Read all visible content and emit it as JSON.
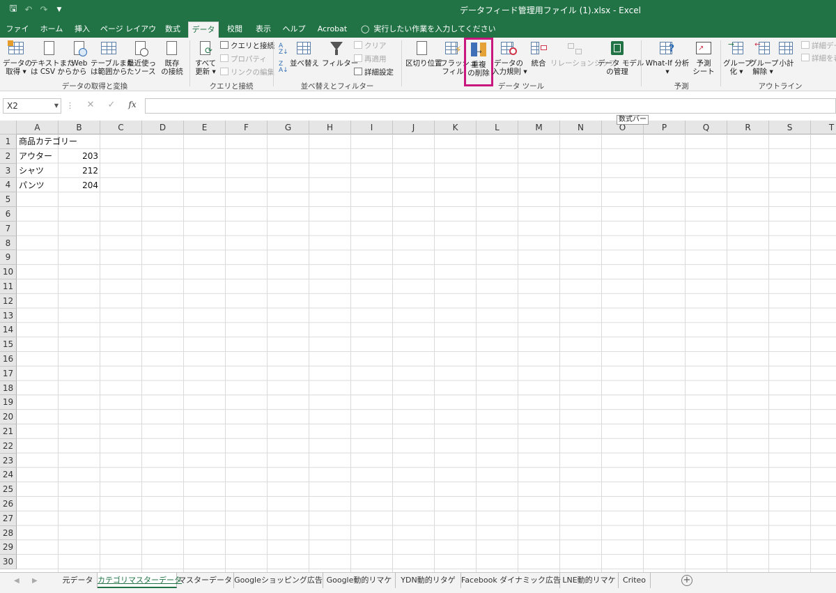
{
  "titlebar": {
    "title": "データフィード管理用ファイル (1).xlsx  -  Excel",
    "qat": {
      "save_icon": "save-icon",
      "undo_icon": "undo-icon",
      "redo_icon": "redo-icon",
      "customize_icon": "customize-qat-icon"
    }
  },
  "tabs": [
    "ファイル",
    "ホーム",
    "挿入",
    "ページ レイアウト",
    "数式",
    "データ",
    "校閲",
    "表示",
    "ヘルプ",
    "Acrobat"
  ],
  "active_tab": "データ",
  "tell_me": "実行したい作業を入力してください",
  "ribbon": {
    "get_data": {
      "group": "データの取得と変換",
      "buttons": [
        {
          "l1": "データの",
          "l2": "取得 ▾"
        },
        {
          "l1": "テキストまた",
          "l2": "は CSV から"
        },
        {
          "l1": "Web",
          "l2": "から"
        },
        {
          "l1": "テーブルまた",
          "l2": "は範囲から"
        },
        {
          "l1": "最近使っ",
          "l2": "たソース"
        },
        {
          "l1": "既存",
          "l2": "の接続"
        }
      ]
    },
    "queries": {
      "group": "クエリと接続",
      "refresh": {
        "l1": "すべて",
        "l2": "更新 ▾"
      },
      "small": [
        "クエリと接続",
        "プロパティ",
        "リンクの編集"
      ]
    },
    "sort_filter": {
      "group": "並べ替えとフィルター",
      "sort": "並べ替え",
      "filter": "フィルター",
      "clear": "クリア",
      "reapply": "再適用",
      "advanced": "詳細設定"
    },
    "data_tools": {
      "group": "データ ツール",
      "buttons": [
        {
          "l1": "区切り位置",
          "l2": ""
        },
        {
          "l1": "フラッシュ",
          "l2": "フィル"
        },
        {
          "l1": "重複",
          "l2": "の削除"
        },
        {
          "l1": "データの",
          "l2": "入力規則 ▾"
        },
        {
          "l1": "統合",
          "l2": ""
        },
        {
          "l1": "リレーションシップ",
          "l2": ""
        },
        {
          "l1": "データ モデル",
          "l2": "の管理"
        }
      ],
      "highlight_color": "#c8187d"
    },
    "forecast": {
      "group": "予測",
      "whatif": {
        "l1": "What-If 分析",
        "l2": "▾"
      },
      "sheet": {
        "l1": "予測",
        "l2": "シート"
      }
    },
    "outline": {
      "group": "アウトライン",
      "buttons": [
        {
          "l1": "グループ",
          "l2": "化 ▾"
        },
        {
          "l1": "グループ",
          "l2": "解除 ▾"
        },
        {
          "l1": "小計",
          "l2": ""
        }
      ],
      "small": [
        "詳細デー",
        "詳細を表"
      ]
    }
  },
  "formula_bar": {
    "name_box": "X2",
    "tooltip": "数式バー",
    "value": ""
  },
  "grid": {
    "columns": [
      "A",
      "B",
      "C",
      "D",
      "E",
      "F",
      "G",
      "H",
      "I",
      "J",
      "K",
      "L",
      "M",
      "N",
      "O",
      "P",
      "Q",
      "R",
      "S",
      "T"
    ],
    "rows": [
      "1",
      "2",
      "3",
      "4",
      "5",
      "6",
      "7",
      "8",
      "9",
      "10",
      "11",
      "12",
      "13",
      "14",
      "15",
      "16",
      "17",
      "18",
      "19",
      "20",
      "21",
      "22",
      "23",
      "24",
      "25",
      "26",
      "27",
      "28",
      "29",
      "30"
    ],
    "cells": {
      "A1": "商品カテゴリー",
      "A2": "アウター",
      "B2": "203",
      "A3": "シャツ",
      "B3": "212",
      "A4": "パンツ",
      "B4": "204"
    }
  },
  "sheet_tabs": [
    "元データ",
    "カテゴリマスターデータ",
    "マスターデータ",
    "Googleショッピング広告",
    "Google動的リマケ",
    "YDN動的リタゲ",
    "Facebook ダイナミック広告",
    "LNE動的リマケ",
    "Criteo"
  ],
  "active_sheet": "カテゴリマスターデータ",
  "colors": {
    "excel_green": "#217346",
    "ribbon_bg": "#f3f3f3"
  }
}
